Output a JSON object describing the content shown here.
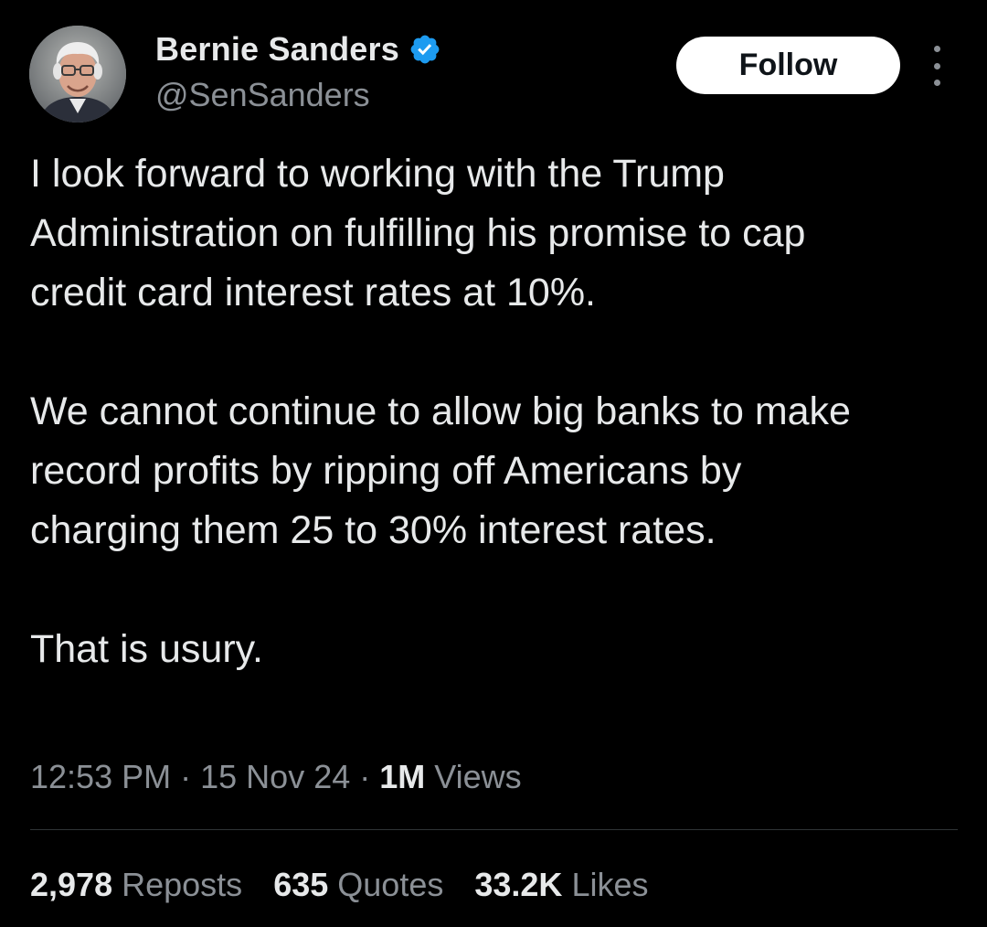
{
  "author": {
    "display_name": "Bernie Sanders",
    "handle": "@SenSanders",
    "verified": true,
    "verified_icon": "verified-badge-icon",
    "verified_color": "#1d9bf0"
  },
  "header": {
    "follow_label": "Follow",
    "more_icon": "more-options-icon"
  },
  "tweet": {
    "paragraphs": [
      "I look forward to working with the Trump Administration on fulfilling his promise to cap credit card interest rates at 10%.",
      "We cannot continue to allow big banks to make record profits by ripping off Americans by charging them 25 to 30% interest rates.",
      "That is usury."
    ]
  },
  "meta": {
    "time": "12:53 PM",
    "separator": "·",
    "date": "15 Nov 24",
    "views_count": "1M",
    "views_label": "Views"
  },
  "stats": {
    "reposts_count": "2,978",
    "reposts_label": "Reposts",
    "quotes_count": "635",
    "quotes_label": "Quotes",
    "likes_count": "33.2K",
    "likes_label": "Likes"
  },
  "colors": {
    "background": "#000000",
    "text_primary": "#e7e9ea",
    "text_secondary": "#8b9096",
    "divider": "#2f3336"
  }
}
